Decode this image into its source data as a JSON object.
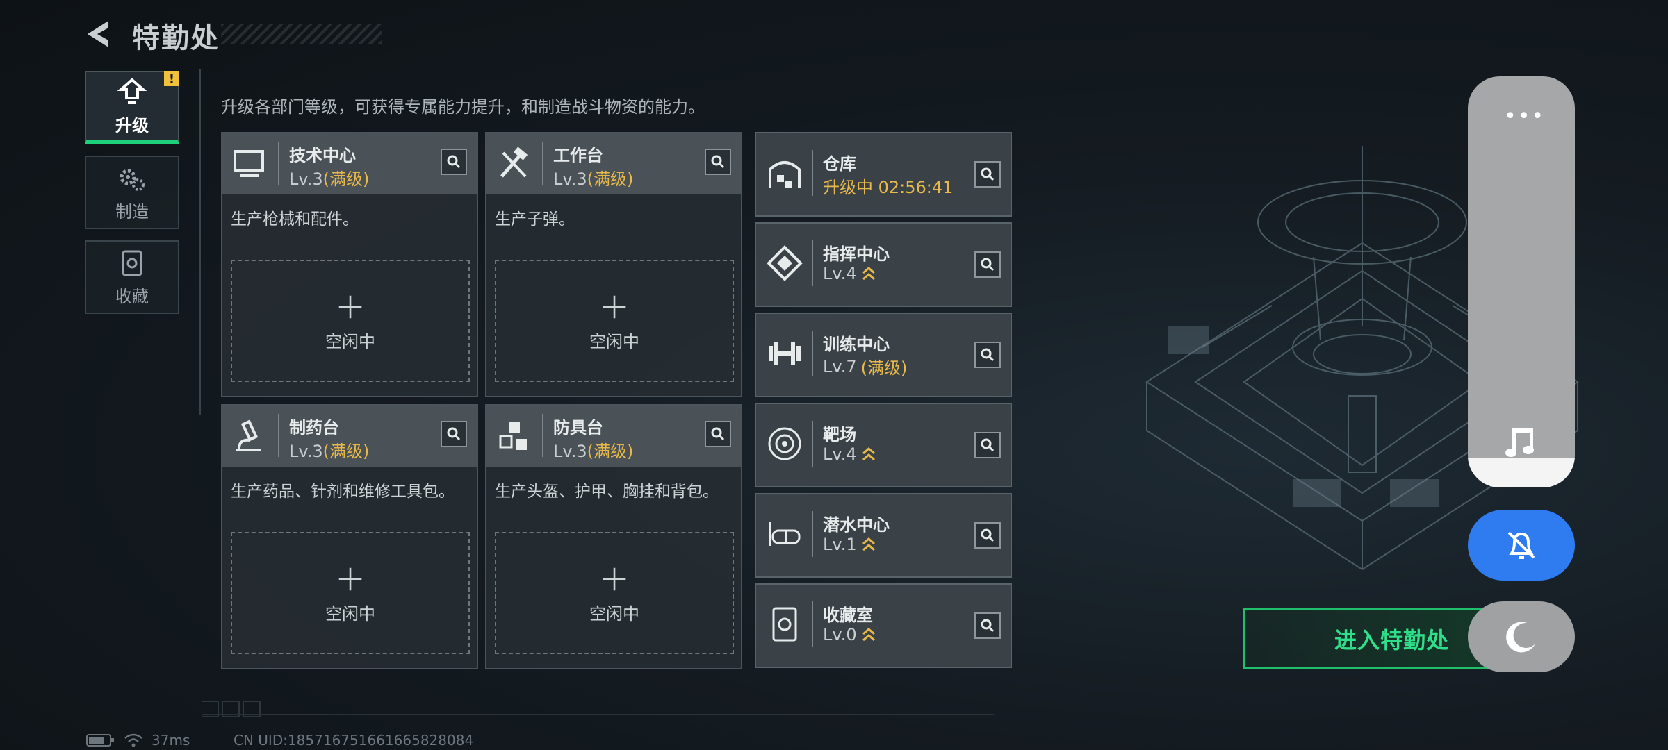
{
  "header": {
    "title": "特勤处"
  },
  "side_tabs": [
    {
      "label": "升级",
      "active": true,
      "icon": "upgrade-icon",
      "badge": "!"
    },
    {
      "label": "制造",
      "active": false,
      "icon": "gears-icon"
    },
    {
      "label": "收藏",
      "active": false,
      "icon": "collection-icon"
    }
  ],
  "subtitle": "升级各部门等级，可获得专属能力提升，和制造战斗物资的能力。",
  "departments": [
    {
      "name": "技术中心",
      "level": "Lv.3",
      "level_note": "(满级)",
      "desc": "生产枪械和配件。",
      "idle_label": "空闲中",
      "icon": "computer-icon"
    },
    {
      "name": "工作台",
      "level": "Lv.3",
      "level_note": "(满级)",
      "desc": "生产子弹。",
      "idle_label": "空闲中",
      "icon": "tools-icon"
    },
    {
      "name": "制药台",
      "level": "Lv.3",
      "level_note": "(满级)",
      "desc": "生产药品、针剂和维修工具包。",
      "idle_label": "空闲中",
      "icon": "microscope-icon"
    },
    {
      "name": "防具台",
      "level": "Lv.3",
      "level_note": "(满级)",
      "desc": "生产头盔、护甲、胸挂和背包。",
      "idle_label": "空闲中",
      "icon": "cubes-icon"
    }
  ],
  "facilities": [
    {
      "name": "仓库",
      "status": "升级中 02:56:41",
      "icon": "warehouse-icon"
    },
    {
      "name": "指挥中心",
      "level": "Lv.4",
      "icon": "command-icon"
    },
    {
      "name": "训练中心",
      "level": "Lv.7",
      "level_note": "(满级)",
      "icon": "dumbbell-icon"
    },
    {
      "name": "靶场",
      "level": "Lv.4",
      "icon": "target-icon"
    },
    {
      "name": "潜水中心",
      "level": "Lv.1",
      "icon": "diving-goggles-icon"
    },
    {
      "name": "收藏室",
      "level": "Lv.0",
      "icon": "collection-room-icon"
    }
  ],
  "enter_button": "进入特勤处",
  "footer": {
    "ping": "37ms",
    "uid": "CN UID:185716751661665828084"
  },
  "colors": {
    "accent_green": "#1fd07a",
    "level_gold": "#e8b94a",
    "overlay_blue": "#2f7bf0"
  }
}
